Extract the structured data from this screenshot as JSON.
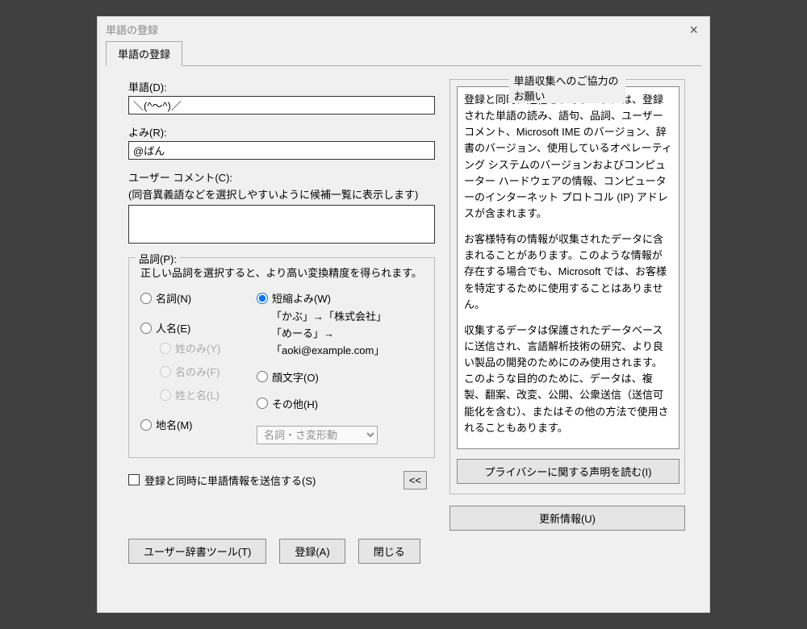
{
  "title": "単語の登録",
  "tab_label": "単語の登録",
  "fields": {
    "tango_label": "単語(D):",
    "tango_value": "＼(^～^)／",
    "yomi_label": "よみ(R):",
    "yomi_value": "@ばん",
    "comment_label": "ユーザー コメント(C):",
    "comment_hint": "(同音異義語などを選択しやすいように候補一覧に表示します)",
    "comment_value": ""
  },
  "hinshi": {
    "legend": "品詞(P):",
    "desc": "正しい品詞を選択すると、より高い変換精度を得られます。",
    "meishi": "名詞(N)",
    "jinmei": "人名(E)",
    "sei_nomi": "姓のみ(Y)",
    "na_nomi": "名のみ(F)",
    "sei_to_na": "姓と名(L)",
    "chimei": "地名(M)",
    "tanshuku": "短縮よみ(W)",
    "ex1": "「かぶ」→「株式会社」",
    "ex2": "「めーる」→「aoki@example.com」",
    "kaomoji": "顔文字(O)",
    "sonota": "その他(H)",
    "select_value": "名詞・さ変形動"
  },
  "send_checkbox_label": "登録と同時に単語情報を送信する(S)",
  "collapse_btn": "<<",
  "bottom": {
    "dict_tool": "ユーザー辞書ツール(T)",
    "register": "登録(A)",
    "close": "閉じる"
  },
  "notice": {
    "legend": "単語収集へのご協力のお願い",
    "p1": "登録と同時に送信されるデータには、登録された単語の読み、語句、品詞、ユーザー コメント、Microsoft IME のバージョン、辞書のバージョン、使用しているオペレーティング システムのバージョンおよびコンピューター ハードウェアの情報、コンピューターのインターネット プロトコル (IP) アドレスが含まれます。",
    "p2": "お客様特有の情報が収集されたデータに含まれることがあります。このような情報が存在する場合でも、Microsoft では、お客様を特定するために使用することはありません。",
    "p3": "収集するデータは保護されたデータベースに送信され、言語解析技術の研究、より良い製品の開発のためにのみ使用されます。このような目的のために、データは、複製、翻案、改変、公開、公衆送信（送信可能化を含む）、またはその他の方法で使用されることもあります。",
    "privacy_btn": "プライバシーに関する声明を読む(I)",
    "update_btn": "更新情報(U)"
  }
}
